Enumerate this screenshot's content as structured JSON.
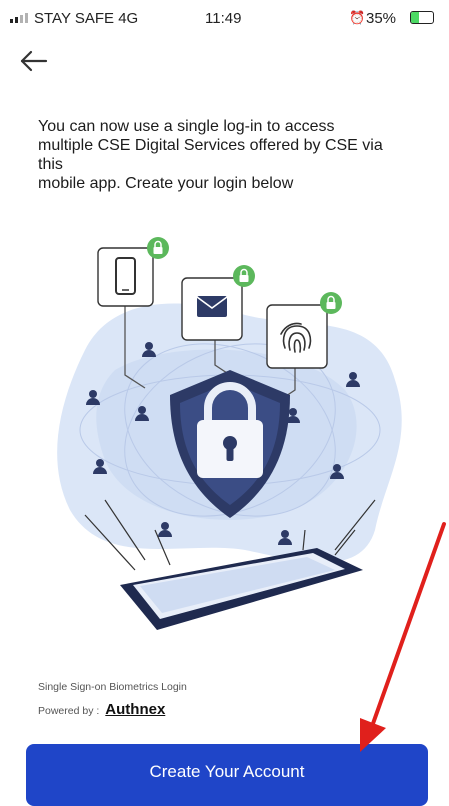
{
  "status_bar": {
    "carrier": "STAY SAFE  4G",
    "time": "11:49",
    "battery": "35%",
    "battery_level": 0.35
  },
  "header": {
    "back_icon": "arrow-left-icon"
  },
  "intro": {
    "lines": [
      "You can now use a single log-in to access",
      "multiple CSE Digital Services offered by CSE via",
      "this",
      "mobile app. Create your login below"
    ]
  },
  "illustration": {
    "icons": [
      "smartphone-icon",
      "envelope-icon",
      "fingerprint-icon",
      "padlock-icon",
      "shield-icon",
      "tablet-icon",
      "user-icon"
    ],
    "colors": {
      "shield": "#2d3a66",
      "accent": "#3b7ae0",
      "badge": "#5cb85c",
      "blob": "#dbe6f7"
    }
  },
  "footer": {
    "caption": "Single Sign-on Biometrics Login",
    "powered_by": "Powered by :",
    "brand": "Authnex"
  },
  "actions": {
    "create_account": "Create Your Account"
  },
  "colors": {
    "primary": "#1f45c8",
    "annotation_arrow": "#e0201c"
  }
}
